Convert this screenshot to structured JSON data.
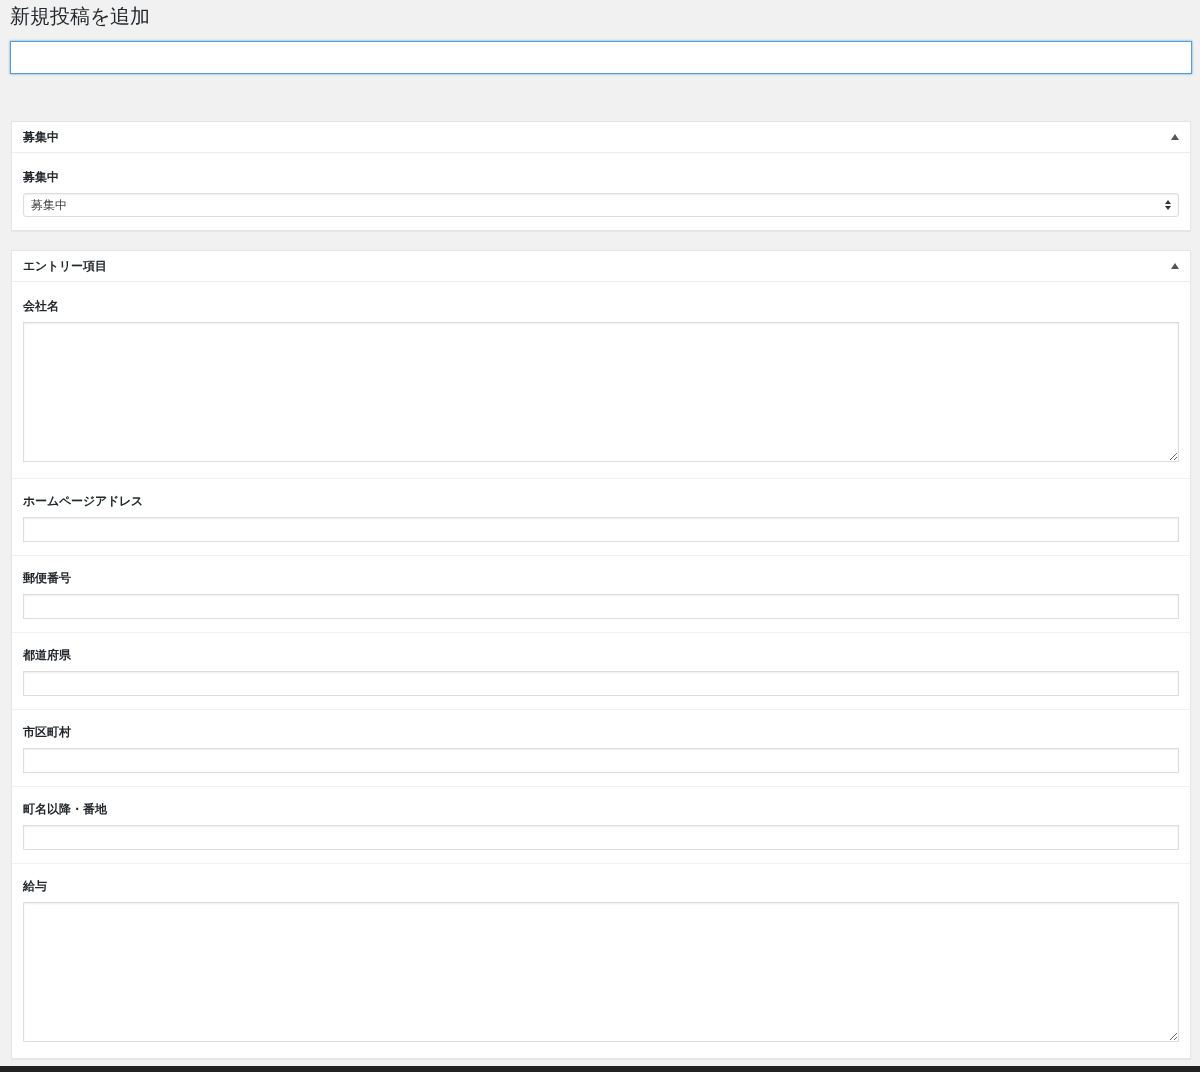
{
  "page_title": "新規投稿を追加",
  "title_field": {
    "focused": true
  },
  "panels": [
    {
      "title": "募集中",
      "expanded": true,
      "fields": [
        {
          "label": "募集中",
          "kind": "select",
          "value": "募集中"
        }
      ]
    },
    {
      "title": "エントリー項目",
      "expanded": true,
      "fields": [
        {
          "label": "会社名",
          "kind": "textarea"
        },
        {
          "label": "ホームページアドレス",
          "kind": "text"
        },
        {
          "label": "郵便番号",
          "kind": "text"
        },
        {
          "label": "都道府県",
          "kind": "text"
        },
        {
          "label": "市区町村",
          "kind": "text"
        },
        {
          "label": "町名以降・番地",
          "kind": "text"
        },
        {
          "label": "給与",
          "kind": "textarea"
        }
      ]
    }
  ]
}
